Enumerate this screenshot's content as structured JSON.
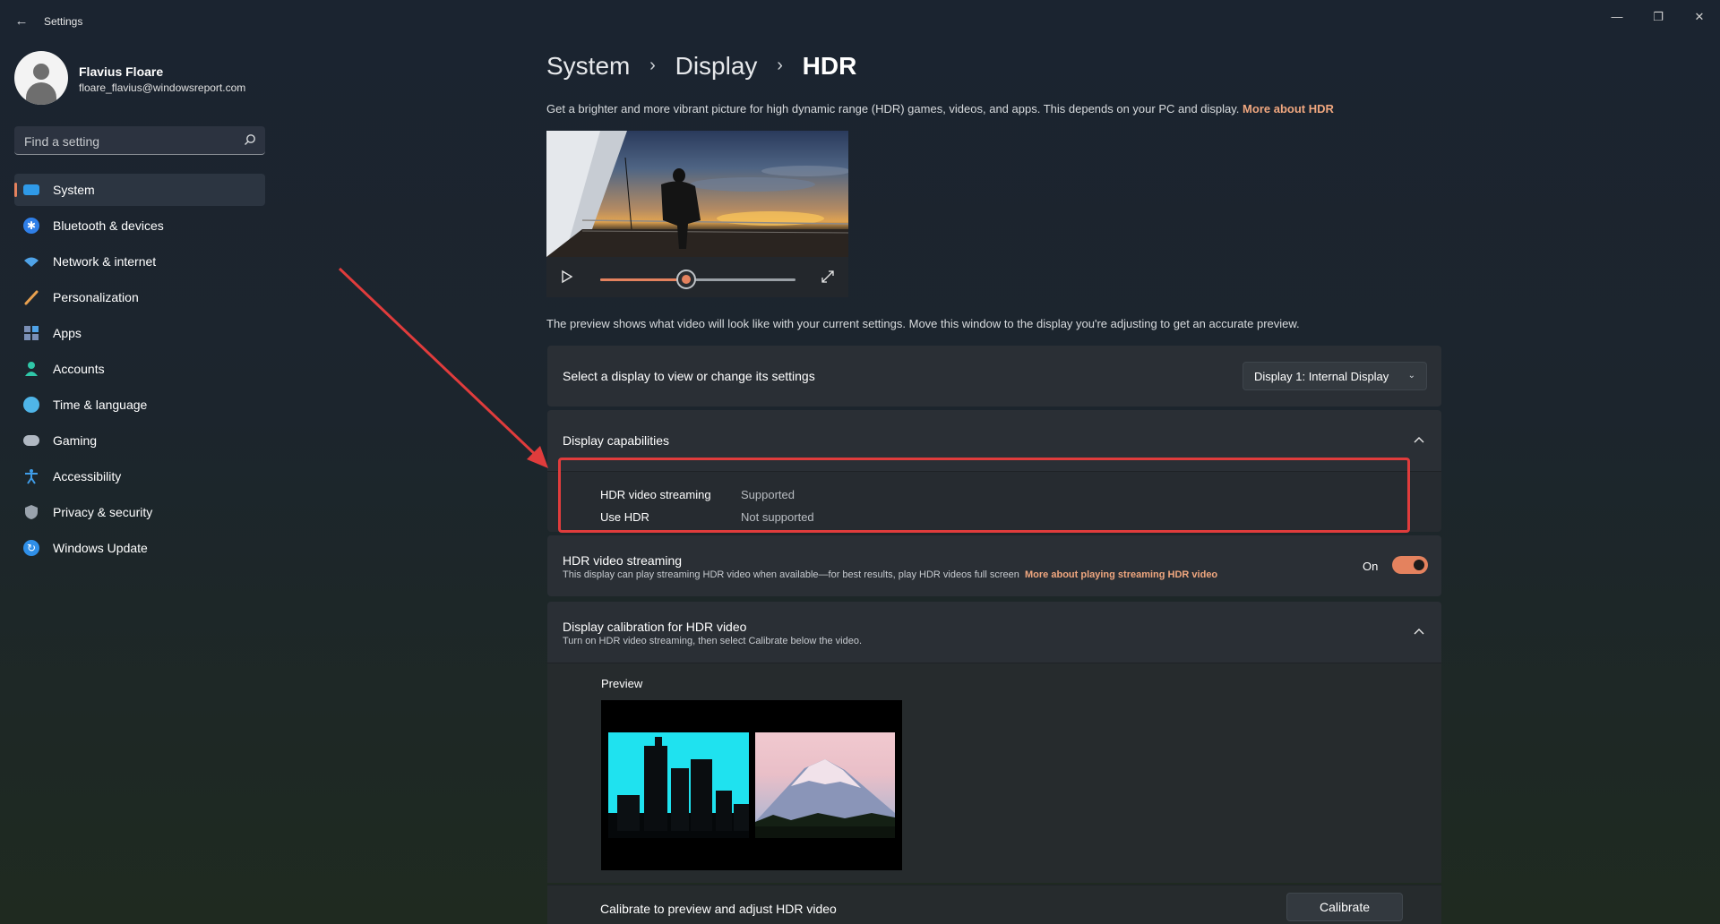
{
  "window": {
    "title": "Settings",
    "controls": {
      "minimize": "—",
      "maximize": "❐",
      "close": "✕"
    }
  },
  "profile": {
    "name": "Flavius Floare",
    "email": "floare_flavius@windowsreport.com"
  },
  "search": {
    "placeholder": "Find a setting"
  },
  "sidebar": {
    "items": [
      {
        "label": "System",
        "icon": "system-icon",
        "color": "#2f9ae8",
        "active": true
      },
      {
        "label": "Bluetooth & devices",
        "icon": "bluetooth-icon",
        "color": "#2f7fe8"
      },
      {
        "label": "Network & internet",
        "icon": "wifi-icon",
        "color": "#4fa3e8"
      },
      {
        "label": "Personalization",
        "icon": "paintbrush-icon",
        "color": "#e8a04f"
      },
      {
        "label": "Apps",
        "icon": "apps-icon",
        "color": "#7a8fb5"
      },
      {
        "label": "Accounts",
        "icon": "person-icon",
        "color": "#2fc7a8"
      },
      {
        "label": "Time & language",
        "icon": "globe-clock-icon",
        "color": "#4fb5e8"
      },
      {
        "label": "Gaming",
        "icon": "gamepad-icon",
        "color": "#b0b8c2"
      },
      {
        "label": "Accessibility",
        "icon": "accessibility-icon",
        "color": "#3f9de8"
      },
      {
        "label": "Privacy & security",
        "icon": "shield-icon",
        "color": "#9aa3ad"
      },
      {
        "label": "Windows Update",
        "icon": "update-icon",
        "color": "#2f8fe8"
      }
    ]
  },
  "breadcrumb": {
    "level1": "System",
    "level2": "Display",
    "current": "HDR"
  },
  "intro": {
    "text": "Get a brighter and more vibrant picture for high dynamic range (HDR) games, videos, and apps. This depends on your PC and display. ",
    "link": "More about HDR"
  },
  "video_preview": {
    "progress": 0.44
  },
  "preview_note": "The preview shows what video will look like with your current settings. Move this window to the display you're adjusting to get an accurate preview.",
  "display_select": {
    "label": "Select a display to view or change its settings",
    "value": "Display 1: Internal Display"
  },
  "capabilities": {
    "title": "Display capabilities",
    "rows": [
      {
        "key": "HDR video streaming",
        "value": "Supported"
      },
      {
        "key": "Use HDR",
        "value": "Not supported"
      }
    ]
  },
  "hdr_streaming": {
    "title": "HDR video streaming",
    "description": "This display can play streaming HDR video when available—for best results, play HDR videos full screen",
    "link": "More about playing streaming HDR video",
    "state": "On",
    "enabled": true
  },
  "calibration": {
    "title": "Display calibration for HDR video",
    "description": "Turn on HDR video streaming, then select Calibrate below the video.",
    "preview_label": "Preview",
    "row_label": "Calibrate to preview and adjust HDR video",
    "button": "Calibrate"
  },
  "colors": {
    "accent": "#e4825e",
    "link": "#f0a77f",
    "annotation": "#e03c3c"
  }
}
